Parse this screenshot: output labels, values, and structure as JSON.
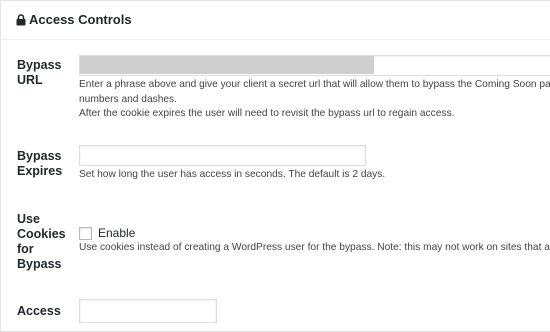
{
  "panel": {
    "title": "Access Controls",
    "icon": "lock-icon"
  },
  "bypass_url": {
    "label_line1": "Bypass",
    "label_line2": "URL",
    "value": "",
    "help_line1": "Enter a phrase above and give your client a secret url that will allow them to bypass the Coming Soon pa",
    "help_line2": "numbers and dashes.",
    "help_line3": "After the cookie expires the user will need to revisit the bypass url to regain access."
  },
  "bypass_expires": {
    "label_line1": "Bypass",
    "label_line2": "Expires",
    "value": "",
    "help": "Set how long the user has access in seconds. The default is 2 days."
  },
  "use_cookies": {
    "label_line1": "Use",
    "label_line2": "Cookies",
    "label_line3": "for",
    "label_line4": "Bypass",
    "checkbox_label": "Enable",
    "checked": false,
    "help": "Use cookies instead of creating a WordPress user for the bypass. Note: this may not work on sites that a"
  },
  "access": {
    "label": "Access",
    "value": ""
  }
}
